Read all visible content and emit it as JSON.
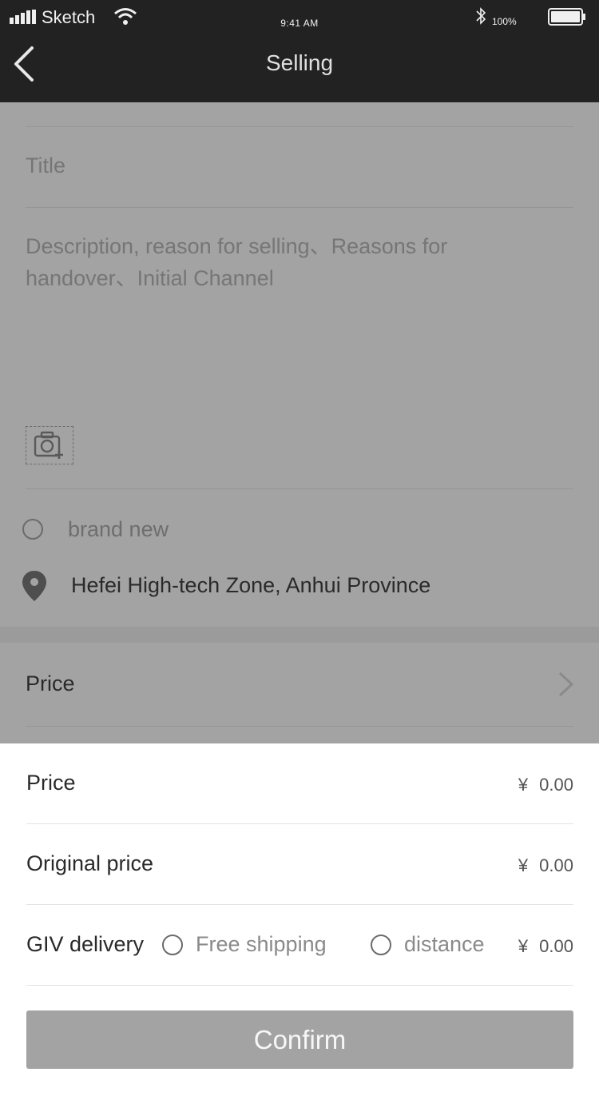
{
  "status_bar": {
    "carrier": "Sketch",
    "time": "9:41 AM",
    "battery_percent": "100%"
  },
  "nav": {
    "title": "Selling"
  },
  "form": {
    "title_placeholder": "Title",
    "description_placeholder": "Description, reason for selling、Reasons for handover、Initial Channel",
    "condition_label": "brand new",
    "location": "Hefei High-tech Zone, Anhui Province",
    "price_row_label": "Price"
  },
  "price_sheet": {
    "price": {
      "label": "Price",
      "currency": "¥",
      "value": "0.00"
    },
    "original_price": {
      "label": "Original price",
      "currency": "¥",
      "value": "0.00"
    },
    "delivery": {
      "label": "GIV delivery",
      "option_free": "Free shipping",
      "option_distance": "distance",
      "currency": "¥",
      "value": "0.00"
    },
    "confirm_label": "Confirm"
  },
  "icons": {
    "back": "chevron-left-icon",
    "camera": "camera-plus-icon",
    "location": "map-pin-icon",
    "price_arrow": "chevron-right-icon"
  },
  "colors": {
    "nav_background": "#222222",
    "overlay_background": "#a3a3a3",
    "confirm_background": "#a3a3a3"
  }
}
